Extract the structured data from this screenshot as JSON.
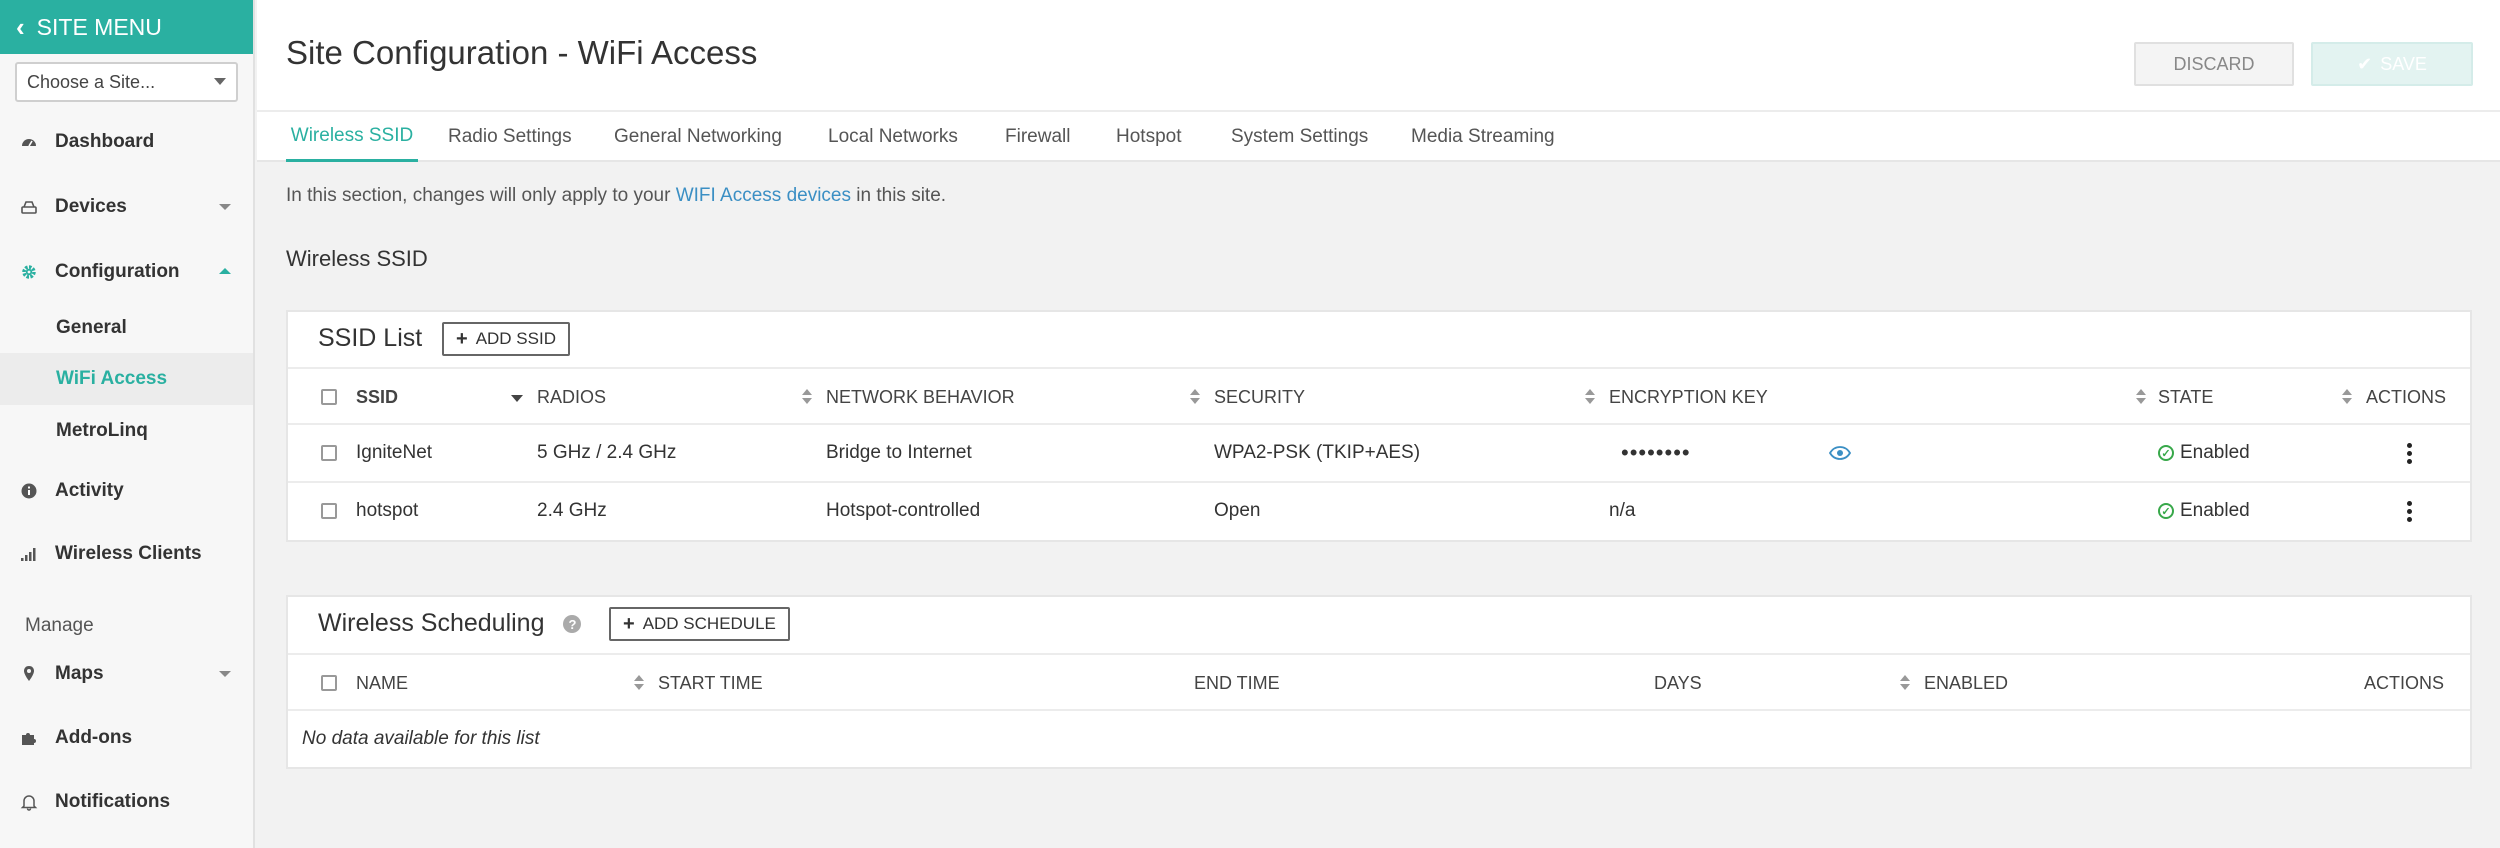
{
  "sidebar": {
    "title": "SITE MENU",
    "site_select": "Choose a Site...",
    "items": {
      "dashboard": "Dashboard",
      "devices": "Devices",
      "configuration": "Configuration",
      "activity": "Activity",
      "wireless_clients": "Wireless Clients",
      "maps": "Maps",
      "addons": "Add-ons",
      "notifications": "Notifications"
    },
    "config_sub": {
      "general": "General",
      "wifi_access": "WiFi Access",
      "metrolinq": "MetroLinq"
    },
    "manage_label": "Manage"
  },
  "header": {
    "title": "Site Configuration - WiFi Access",
    "discard": "DISCARD",
    "save": "SAVE"
  },
  "tabs": [
    "Wireless SSID",
    "Radio Settings",
    "General Networking",
    "Local Networks",
    "Firewall",
    "Hotspot",
    "System Settings",
    "Media Streaming"
  ],
  "notice": {
    "before": "In this section, changes will only apply to your ",
    "link": "WIFI Access devices",
    "after": " in this site."
  },
  "section_heading": "Wireless SSID",
  "ssid_list": {
    "title": "SSID List",
    "add_button": "ADD SSID",
    "columns": {
      "ssid": "SSID",
      "radios": "RADIOS",
      "network_behavior": "NETWORK BEHAVIOR",
      "security": "SECURITY",
      "encryption_key": "ENCRYPTION KEY",
      "state": "STATE",
      "actions": "ACTIONS"
    },
    "rows": [
      {
        "ssid": "IgniteNet",
        "radios": "5 GHz / 2.4 GHz",
        "network_behavior": "Bridge to Internet",
        "security": "WPA2-PSK (TKIP+AES)",
        "encryption_key": "••••••••",
        "state": "Enabled"
      },
      {
        "ssid": "hotspot",
        "radios": "2.4 GHz",
        "network_behavior": "Hotspot-controlled",
        "security": "Open",
        "encryption_key": "n/a",
        "state": "Enabled"
      }
    ]
  },
  "scheduling": {
    "title": "Wireless Scheduling",
    "add_button": "ADD SCHEDULE",
    "columns": {
      "name": "NAME",
      "start_time": "START TIME",
      "end_time": "END TIME",
      "days": "DAYS",
      "enabled": "ENABLED",
      "actions": "ACTIONS"
    },
    "empty": "No data available for this list"
  },
  "colors": {
    "accent": "#2ab0a1",
    "link": "#3b8fc4",
    "enabled": "#38a84a"
  }
}
